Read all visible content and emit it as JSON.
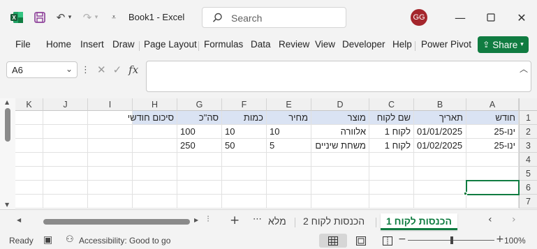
{
  "titlebar": {
    "doc_title": "Book1  -  Excel",
    "search_placeholder": "Search",
    "user_initials": "GG",
    "accent": "#107c41",
    "avatar_color": "#a4262c"
  },
  "ribbon": {
    "tabs": [
      "File",
      "Home",
      "Insert",
      "Draw",
      "Page Layout",
      "Formulas",
      "Data",
      "Review",
      "View",
      "Developer",
      "Help",
      "Power Pivot"
    ],
    "share_label": "Share"
  },
  "formula_bar": {
    "name_box": "A6",
    "formula": ""
  },
  "sheet": {
    "columns": [
      "K",
      "J",
      "I",
      "H",
      "G",
      "F",
      "E",
      "D",
      "C",
      "B",
      "A"
    ],
    "row_numbers": [
      "1",
      "2",
      "3",
      "4",
      "5",
      "6",
      "7"
    ],
    "headers": {
      "A": "חודש",
      "B": "תאריך",
      "C": "שם לקוח",
      "D": "מוצר",
      "E": "מחיר",
      "F": "כמות",
      "G": "סה\"כ",
      "H": "סיכום חודשי"
    },
    "rows": [
      {
        "A": "ינו-25",
        "B": "01/01/2025",
        "C": "לקוח 1",
        "D": "אלוורה",
        "E": "10",
        "F": "10",
        "G": "100",
        "H": ""
      },
      {
        "A": "ינו-25",
        "B": "01/02/2025",
        "C": "לקוח 1",
        "D": "משחת שיניים",
        "E": "5",
        "F": "50",
        "G": "250",
        "H": ""
      }
    ],
    "header_fill": "#dae3f3"
  },
  "sheet_tabs": {
    "active": "הכנסות לקוח 1",
    "others": [
      "הכנסות לקוח 2",
      "מלא"
    ]
  },
  "status": {
    "ready": "Ready",
    "accessibility": "Accessibility: Good to go",
    "zoom": "100%"
  }
}
